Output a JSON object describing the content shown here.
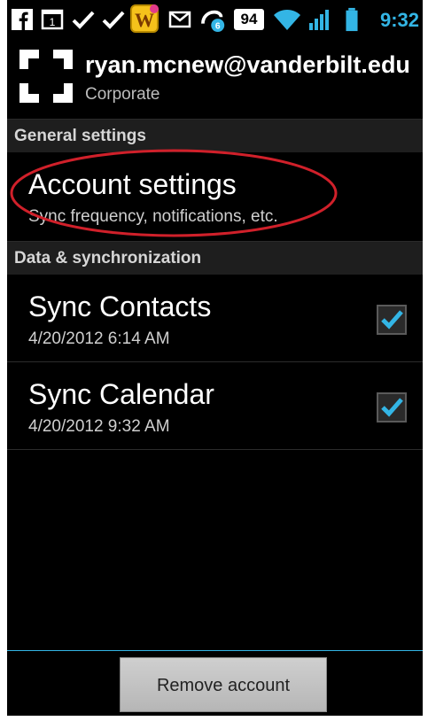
{
  "status_bar": {
    "icons": [
      "facebook-icon",
      "calendar-icon",
      "check-icon",
      "check-icon",
      "words-game-icon",
      "gmail-icon",
      "talk-icon",
      "signal-strength-icon",
      "wifi-icon",
      "cell-signal-icon",
      "battery-icon"
    ],
    "talk_count": "6",
    "signal_badge": "94",
    "calendar_day": "1",
    "time": "9:32",
    "accent_color": "#33b5e5"
  },
  "header": {
    "email": "ryan.mcnew@vanderbilt.edu",
    "account_type": "Corporate"
  },
  "sections": {
    "general": {
      "title": "General settings",
      "items": [
        {
          "title": "Account settings",
          "subtitle": "Sync frequency, notifications, etc."
        }
      ]
    },
    "data_sync": {
      "title": "Data & synchronization",
      "items": [
        {
          "title": "Sync Contacts",
          "subtitle": "4/20/2012 6:14 AM",
          "checked": true
        },
        {
          "title": "Sync Calendar",
          "subtitle": "4/20/2012 9:32 AM",
          "checked": true
        }
      ]
    }
  },
  "footer": {
    "remove_button": "Remove account"
  },
  "annotation": {
    "color": "#d0202a"
  }
}
